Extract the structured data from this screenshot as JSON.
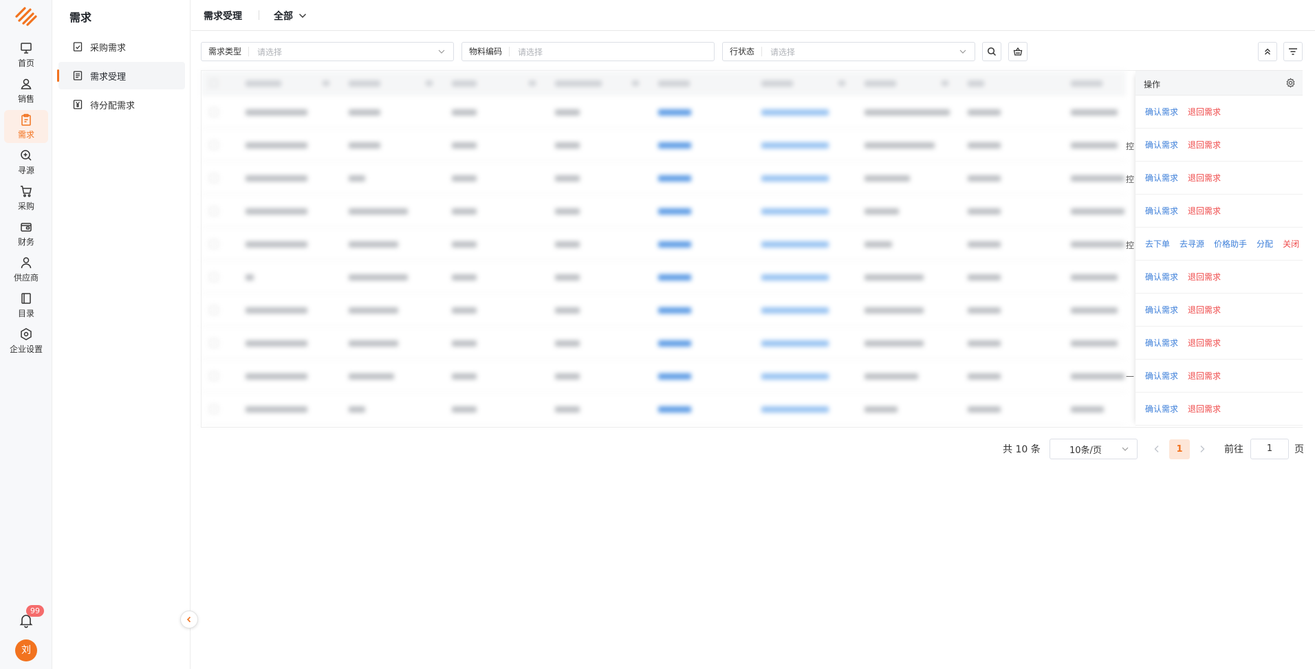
{
  "rail": {
    "items": [
      {
        "label": "首页",
        "icon": "monitor-icon"
      },
      {
        "label": "销售",
        "icon": "user-icon"
      },
      {
        "label": "需求",
        "icon": "clipboard-icon"
      },
      {
        "label": "寻源",
        "icon": "search-zoom-icon"
      },
      {
        "label": "采购",
        "icon": "cart-icon"
      },
      {
        "label": "财务",
        "icon": "wallet-icon"
      },
      {
        "label": "供应商",
        "icon": "supplier-icon"
      },
      {
        "label": "目录",
        "icon": "catalog-icon"
      },
      {
        "label": "企业设置",
        "icon": "hexagon-gear-icon"
      }
    ],
    "notification_count": "99",
    "avatar_text": "刘",
    "accent": "#f2731f"
  },
  "submenu": {
    "title": "需求",
    "items": [
      {
        "label": "采购需求",
        "icon": "check-doc-icon"
      },
      {
        "label": "需求受理",
        "icon": "doc-list-icon"
      },
      {
        "label": "待分配需求",
        "icon": "yen-doc-icon"
      }
    ]
  },
  "header": {
    "title": "需求受理",
    "scope": "全部"
  },
  "filters": [
    {
      "label": "需求类型",
      "placeholder": "请选择"
    },
    {
      "label": "物料编码",
      "placeholder": "请选择"
    },
    {
      "label": "行状态",
      "placeholder": "请选择"
    }
  ],
  "table": {
    "ops_header": "操作",
    "edge_texts": [
      "",
      "控",
      "控",
      "",
      "控",
      "",
      "",
      "",
      "—",
      ""
    ],
    "rows": [
      {
        "actions": [
          {
            "label": "确认需求",
            "type": "link"
          },
          {
            "label": "退回需求",
            "type": "danger"
          }
        ]
      },
      {
        "actions": [
          {
            "label": "确认需求",
            "type": "link"
          },
          {
            "label": "退回需求",
            "type": "danger"
          }
        ]
      },
      {
        "actions": [
          {
            "label": "确认需求",
            "type": "link"
          },
          {
            "label": "退回需求",
            "type": "danger"
          }
        ]
      },
      {
        "actions": [
          {
            "label": "确认需求",
            "type": "link"
          },
          {
            "label": "退回需求",
            "type": "danger"
          }
        ]
      },
      {
        "actions": [
          {
            "label": "去下单",
            "type": "link"
          },
          {
            "label": "去寻源",
            "type": "link"
          },
          {
            "label": "价格助手",
            "type": "link"
          },
          {
            "label": "分配",
            "type": "link"
          },
          {
            "label": "关闭",
            "type": "danger"
          }
        ]
      },
      {
        "actions": [
          {
            "label": "确认需求",
            "type": "link"
          },
          {
            "label": "退回需求",
            "type": "danger"
          }
        ]
      },
      {
        "actions": [
          {
            "label": "确认需求",
            "type": "link"
          },
          {
            "label": "退回需求",
            "type": "danger"
          }
        ]
      },
      {
        "actions": [
          {
            "label": "确认需求",
            "type": "link"
          },
          {
            "label": "退回需求",
            "type": "danger"
          }
        ]
      },
      {
        "actions": [
          {
            "label": "确认需求",
            "type": "link"
          },
          {
            "label": "退回需求",
            "type": "danger"
          }
        ]
      },
      {
        "actions": [
          {
            "label": "确认需求",
            "type": "link"
          },
          {
            "label": "退回需求",
            "type": "danger"
          }
        ]
      }
    ]
  },
  "pagination": {
    "total": "共 10 条",
    "page_size": "10条/页",
    "current": "1",
    "goto_prefix": "前往",
    "goto_value": "1",
    "goto_suffix": "页"
  }
}
